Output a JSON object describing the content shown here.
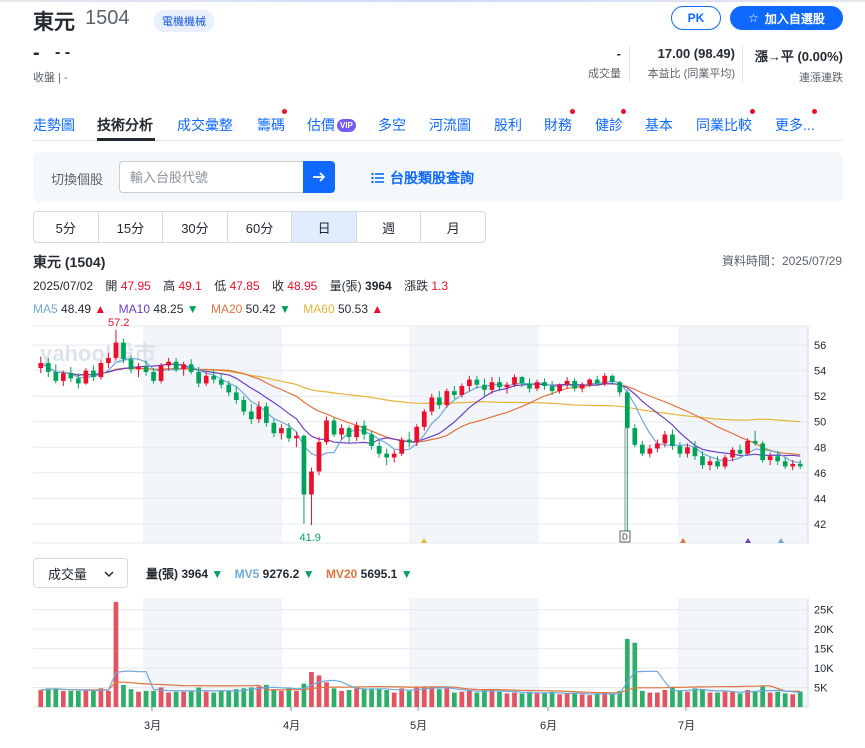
{
  "stock": {
    "name": "東元",
    "code": "1504",
    "tag": "電機機械"
  },
  "actions": {
    "pk_label": "PK",
    "watchlist_label": "加入自選股"
  },
  "quote": {
    "price": "-",
    "change": "- -",
    "close_label": "收盤 | -",
    "stats": [
      {
        "value": "-",
        "label": "成交量"
      },
      {
        "value": "17.00 (98.49)",
        "label": "本益比 (同業平均)"
      },
      {
        "value": "漲→平 (0.00%)",
        "label": "連漲連跌"
      }
    ]
  },
  "nav": {
    "items": [
      {
        "label": "走勢圖",
        "dot": false
      },
      {
        "label": "技術分析",
        "dot": false,
        "active": true
      },
      {
        "label": "成交彙整",
        "dot": false
      },
      {
        "label": "籌碼",
        "dot": true
      },
      {
        "label": "估價",
        "dot": false,
        "vip": "VIP"
      },
      {
        "label": "多空",
        "dot": false
      },
      {
        "label": "河流圖",
        "dot": false
      },
      {
        "label": "股利",
        "dot": false
      },
      {
        "label": "財務",
        "dot": true
      },
      {
        "label": "健診",
        "dot": true
      },
      {
        "label": "基本",
        "dot": false
      },
      {
        "label": "同業比較",
        "dot": true
      },
      {
        "label": "更多...",
        "dot": true
      }
    ]
  },
  "search": {
    "label": "切換個股",
    "placeholder": "輸入台股代號",
    "category_link": "台股類股查詢"
  },
  "periods": [
    {
      "label": "5分"
    },
    {
      "label": "15分"
    },
    {
      "label": "30分"
    },
    {
      "label": "60分"
    },
    {
      "label": "日",
      "active": true
    },
    {
      "label": "週"
    },
    {
      "label": "月"
    }
  ],
  "chart_info": {
    "title": "東元 (1504)",
    "data_time": "資料時間：2025/07/29",
    "date": "2025/07/02",
    "open_label": "開",
    "open": "47.95",
    "high_label": "高",
    "high": "49.1",
    "low_label": "低",
    "low": "47.85",
    "close_label": "收",
    "close": "48.95",
    "volume_label": "量(張)",
    "volume": "3964",
    "change_label": "漲跌",
    "change": "1.3"
  },
  "ma": [
    {
      "label": "MA5",
      "value": "48.49",
      "dir": "▲",
      "color": "#6fa8dc"
    },
    {
      "label": "MA10",
      "value": "48.25",
      "dir": "▼",
      "color": "#6c3fc4"
    },
    {
      "label": "MA20",
      "value": "50.42",
      "dir": "▼",
      "color": "#e0743d"
    },
    {
      "label": "MA60",
      "value": "50.53",
      "dir": "▲",
      "color": "#e6b33a"
    }
  ],
  "volume_panel": {
    "select_label": "成交量",
    "legend": [
      {
        "label": "量(張)",
        "value": "3964",
        "dir": "▼",
        "color": "#232a31"
      },
      {
        "label": "MV5",
        "value": "9276.2",
        "dir": "▼",
        "color": "#6fa8dc"
      },
      {
        "label": "MV20",
        "value": "5695.1",
        "dir": "▼",
        "color": "#e0743d"
      }
    ]
  },
  "chart_data": [
    {
      "type": "candlestick",
      "y_ticks": [
        42,
        44,
        46,
        48,
        50,
        52,
        54,
        56
      ],
      "ylim": [
        40.5,
        57.5
      ],
      "annotations": {
        "high_label": "57.2",
        "low_label": "41.9",
        "marker": "D"
      },
      "watermark": "yahoo!股市",
      "candles": [
        [
          54.2,
          55.1,
          53.8,
          54.6
        ],
        [
          54.6,
          55.0,
          53.5,
          53.9
        ],
        [
          53.9,
          54.5,
          53.0,
          53.2
        ],
        [
          53.2,
          54.0,
          52.8,
          53.8
        ],
        [
          53.8,
          54.3,
          53.1,
          53.4
        ],
        [
          53.4,
          53.8,
          52.6,
          53.0
        ],
        [
          53.0,
          54.2,
          52.9,
          54.0
        ],
        [
          54.0,
          54.4,
          53.2,
          53.5
        ],
        [
          53.5,
          54.8,
          53.3,
          54.6
        ],
        [
          54.6,
          55.4,
          54.2,
          55.0
        ],
        [
          55.0,
          57.2,
          54.8,
          56.2
        ],
        [
          56.2,
          56.5,
          54.6,
          54.9
        ],
        [
          54.9,
          55.2,
          53.8,
          54.1
        ],
        [
          54.1,
          54.6,
          53.5,
          54.3
        ],
        [
          54.3,
          54.8,
          53.6,
          53.9
        ],
        [
          53.9,
          54.2,
          53.0,
          53.2
        ],
        [
          53.2,
          54.6,
          53.0,
          54.4
        ],
        [
          54.4,
          55.0,
          54.0,
          54.7
        ],
        [
          54.7,
          55.0,
          53.9,
          54.1
        ],
        [
          54.1,
          54.7,
          53.6,
          54.5
        ],
        [
          54.5,
          54.9,
          53.7,
          53.9
        ],
        [
          53.9,
          54.3,
          52.7,
          53.0
        ],
        [
          53.0,
          53.9,
          52.8,
          53.6
        ],
        [
          53.6,
          54.0,
          53.0,
          53.3
        ],
        [
          53.3,
          53.8,
          52.6,
          52.9
        ],
        [
          52.9,
          53.2,
          52.0,
          52.3
        ],
        [
          52.3,
          52.8,
          51.4,
          51.7
        ],
        [
          51.7,
          52.0,
          50.5,
          50.8
        ],
        [
          50.8,
          51.4,
          49.8,
          50.2
        ],
        [
          50.2,
          51.6,
          49.9,
          51.2
        ],
        [
          51.2,
          51.5,
          49.6,
          49.9
        ],
        [
          49.9,
          50.2,
          48.8,
          49.1
        ],
        [
          49.1,
          49.8,
          48.6,
          49.5
        ],
        [
          49.5,
          49.9,
          48.4,
          48.7
        ],
        [
          48.7,
          49.2,
          48.0,
          48.9
        ],
        [
          48.9,
          49.0,
          42.0,
          44.3
        ],
        [
          44.3,
          46.4,
          41.9,
          46.1
        ],
        [
          46.1,
          48.8,
          45.8,
          48.4
        ],
        [
          48.4,
          50.4,
          48.2,
          50.1
        ],
        [
          50.1,
          50.3,
          48.8,
          49.0
        ],
        [
          49.0,
          49.8,
          48.6,
          49.5
        ],
        [
          49.5,
          49.7,
          48.4,
          48.8
        ],
        [
          48.8,
          50.0,
          48.5,
          49.7
        ],
        [
          49.7,
          50.1,
          48.6,
          49.0
        ],
        [
          49.0,
          49.3,
          47.8,
          48.1
        ],
        [
          48.1,
          48.6,
          47.2,
          47.5
        ],
        [
          47.5,
          47.9,
          46.6,
          47.2
        ],
        [
          47.2,
          47.8,
          46.8,
          47.5
        ],
        [
          47.5,
          48.8,
          47.3,
          48.6
        ],
        [
          48.6,
          49.2,
          48.0,
          48.4
        ],
        [
          48.4,
          49.8,
          48.1,
          49.6
        ],
        [
          49.6,
          51.0,
          49.3,
          50.8
        ],
        [
          50.8,
          52.2,
          50.5,
          51.9
        ],
        [
          51.9,
          52.4,
          51.0,
          51.3
        ],
        [
          51.3,
          52.6,
          51.1,
          52.4
        ],
        [
          52.4,
          52.8,
          51.8,
          52.1
        ],
        [
          52.1,
          53.0,
          51.9,
          52.8
        ],
        [
          52.8,
          53.6,
          52.4,
          53.3
        ],
        [
          53.3,
          53.6,
          52.6,
          52.9
        ],
        [
          52.9,
          53.4,
          52.0,
          52.5
        ],
        [
          52.5,
          53.5,
          52.2,
          53.1
        ],
        [
          53.1,
          53.5,
          52.4,
          52.7
        ],
        [
          52.7,
          53.1,
          52.2,
          52.9
        ],
        [
          52.9,
          53.7,
          52.7,
          53.5
        ],
        [
          53.5,
          53.6,
          52.7,
          53.0
        ],
        [
          53.0,
          53.4,
          52.3,
          52.6
        ],
        [
          52.6,
          53.3,
          52.4,
          53.1
        ],
        [
          53.1,
          53.4,
          52.5,
          52.8
        ],
        [
          52.8,
          53.2,
          52.1,
          52.4
        ],
        [
          52.4,
          53.0,
          52.2,
          52.9
        ],
        [
          52.9,
          53.5,
          52.6,
          53.2
        ],
        [
          53.2,
          53.4,
          52.4,
          52.6
        ],
        [
          52.6,
          53.1,
          52.3,
          52.9
        ],
        [
          52.9,
          53.4,
          52.7,
          53.3
        ],
        [
          53.3,
          53.6,
          52.8,
          53.0
        ],
        [
          53.0,
          53.8,
          52.8,
          53.6
        ],
        [
          53.6,
          53.7,
          52.9,
          53.1
        ],
        [
          53.1,
          53.2,
          52.0,
          52.3
        ],
        [
          52.3,
          52.5,
          41.0,
          49.5
        ],
        [
          49.5,
          49.8,
          48.0,
          48.2
        ],
        [
          48.2,
          48.5,
          47.3,
          47.5
        ],
        [
          47.5,
          48.2,
          47.2,
          47.9
        ],
        [
          47.9,
          48.6,
          47.6,
          48.3
        ],
        [
          48.3,
          49.3,
          48.0,
          49.0
        ],
        [
          49.0,
          49.4,
          47.8,
          48.1
        ],
        [
          48.1,
          48.4,
          47.2,
          47.5
        ],
        [
          47.5,
          48.3,
          47.2,
          48.0
        ],
        [
          48.0,
          48.5,
          47.0,
          47.3
        ],
        [
          47.3,
          47.7,
          46.3,
          46.6
        ],
        [
          46.6,
          47.2,
          46.2,
          46.9
        ],
        [
          46.9,
          47.3,
          46.3,
          46.5
        ],
        [
          46.5,
          47.4,
          46.3,
          47.2
        ],
        [
          47.2,
          48.0,
          46.9,
          47.8
        ],
        [
          47.8,
          48.2,
          47.3,
          47.5
        ],
        [
          47.5,
          48.7,
          47.4,
          48.5
        ],
        [
          48.5,
          49.3,
          48.1,
          48.3
        ],
        [
          48.3,
          48.5,
          46.8,
          47.0
        ],
        [
          47.0,
          47.6,
          46.6,
          47.3
        ],
        [
          47.3,
          47.7,
          46.6,
          46.9
        ],
        [
          46.9,
          47.2,
          46.3,
          46.5
        ],
        [
          46.5,
          47.0,
          46.2,
          46.7
        ],
        [
          46.7,
          47.0,
          46.3,
          46.5
        ]
      ]
    },
    {
      "type": "bar",
      "series_name": "成交量",
      "y_ticks": [
        "5K",
        "10K",
        "15K",
        "20K",
        "25K"
      ],
      "ylim": [
        0,
        28000
      ],
      "x_ticks": [
        "3月",
        "4月",
        "5月",
        "6月",
        "7月"
      ],
      "values": [
        3964
      ]
    }
  ]
}
